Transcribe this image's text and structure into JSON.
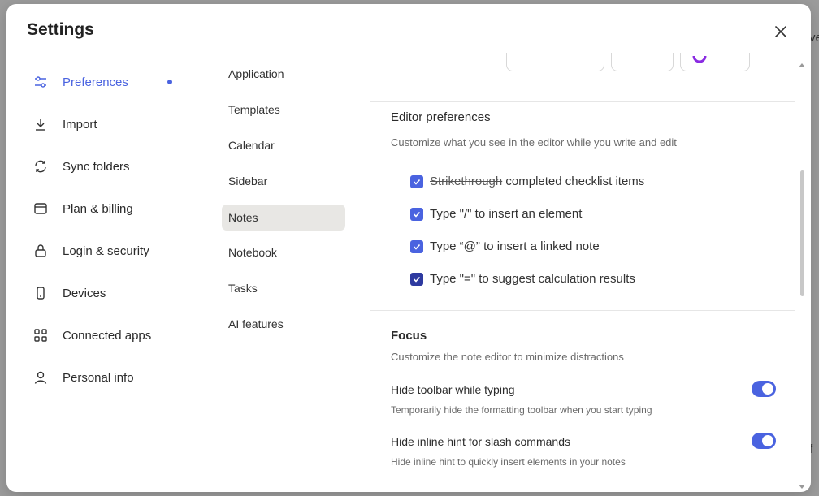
{
  "background": {
    "peek_top": "ve",
    "peek_bottom": "f"
  },
  "modal": {
    "title": "Settings"
  },
  "nav": {
    "items": [
      {
        "label": "Preferences",
        "icon": "sliders-icon",
        "active": true
      },
      {
        "label": "Import",
        "icon": "download-icon"
      },
      {
        "label": "Sync folders",
        "icon": "sync-icon"
      },
      {
        "label": "Plan & billing",
        "icon": "billing-icon"
      },
      {
        "label": "Login & security",
        "icon": "lock-icon"
      },
      {
        "label": "Devices",
        "icon": "phone-icon"
      },
      {
        "label": "Connected apps",
        "icon": "apps-grid-icon"
      },
      {
        "label": "Personal info",
        "icon": "person-icon"
      }
    ]
  },
  "subnav": {
    "items": [
      {
        "label": "Application"
      },
      {
        "label": "Templates"
      },
      {
        "label": "Calendar"
      },
      {
        "label": "Sidebar"
      },
      {
        "label": "Notes",
        "active": true
      },
      {
        "label": "Notebook"
      },
      {
        "label": "Tasks"
      },
      {
        "label": "AI features"
      }
    ]
  },
  "editor": {
    "title": "Editor preferences",
    "description": "Customize what you see in the editor while you write and edit",
    "options": [
      {
        "strike_text": "Strikethrough",
        "text": " completed checklist items",
        "checked": true
      },
      {
        "text": "Type \"/\" to insert an element",
        "checked": true
      },
      {
        "text": "Type “@” to insert a linked note",
        "checked": true
      },
      {
        "text": "Type \"=\" to suggest calculation results",
        "checked": true
      }
    ]
  },
  "focus": {
    "title": "Focus",
    "description": "Customize the note editor to minimize distractions",
    "toggles": [
      {
        "label": "Hide toolbar while typing",
        "description": "Temporarily hide the formatting toolbar when you start typing",
        "on": true
      },
      {
        "label": "Hide inline hint for slash commands",
        "description": "Hide inline hint to quickly insert elements in your notes",
        "on": true
      }
    ]
  },
  "colors": {
    "accent": "#4a63e0",
    "accent_dark": "#2e3aa0",
    "active_bg": "#e8e7e4"
  }
}
